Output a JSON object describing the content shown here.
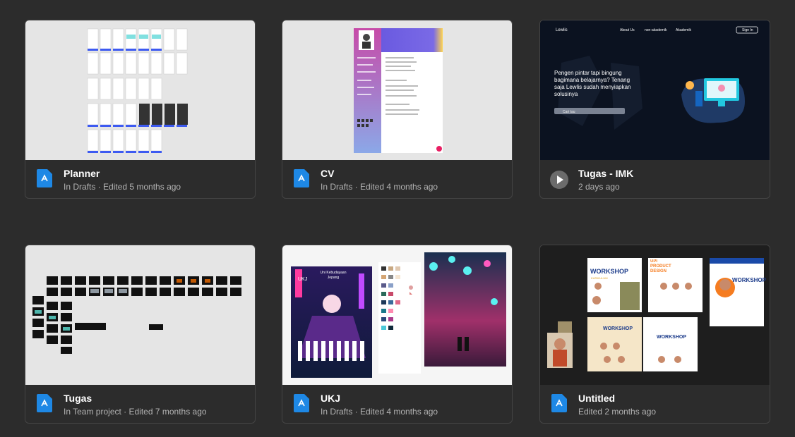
{
  "files": [
    {
      "title": "Planner",
      "subtitle": "In Drafts · Edited 5 months ago",
      "icon": "design-file-icon"
    },
    {
      "title": "CV",
      "subtitle": "In Drafts · Edited 4 months ago",
      "icon": "design-file-icon"
    },
    {
      "title": "Tugas - IMK",
      "subtitle": "2 days ago",
      "icon": "play-icon",
      "preview": {
        "logo": "Lewlis",
        "nav": [
          "About Us",
          "non-akademik",
          "Akademik"
        ],
        "sign_in": "Sign In",
        "headline": "Pengen pintar tapi bingung bagimana belajarnya? Tenang saja Lewlis sudah menyiapkan solusinya",
        "search_placeholder": "Cari tau"
      }
    },
    {
      "title": "Tugas",
      "subtitle": "In Team project · Edited 7 months ago",
      "icon": "design-file-icon"
    },
    {
      "title": "UKJ",
      "subtitle": "In Drafts · Edited 4 months ago",
      "icon": "design-file-icon",
      "preview": {
        "poster_title": "Uni Kebudayaan Jepang",
        "poster_badge": "UKJ"
      }
    },
    {
      "title": "Untitled",
      "subtitle": "Edited 2 months ago",
      "icon": "design-file-icon",
      "preview": {
        "poster_1": "WORKSHOP",
        "poster_2": "UPI PRODUCT DESIGN",
        "poster_3": "WORKSHOP",
        "sub": "KURIKULUM"
      }
    }
  ],
  "colors": {
    "background": "#2c2c2c",
    "file_icon": "#1e88e5",
    "border": "#444444"
  }
}
